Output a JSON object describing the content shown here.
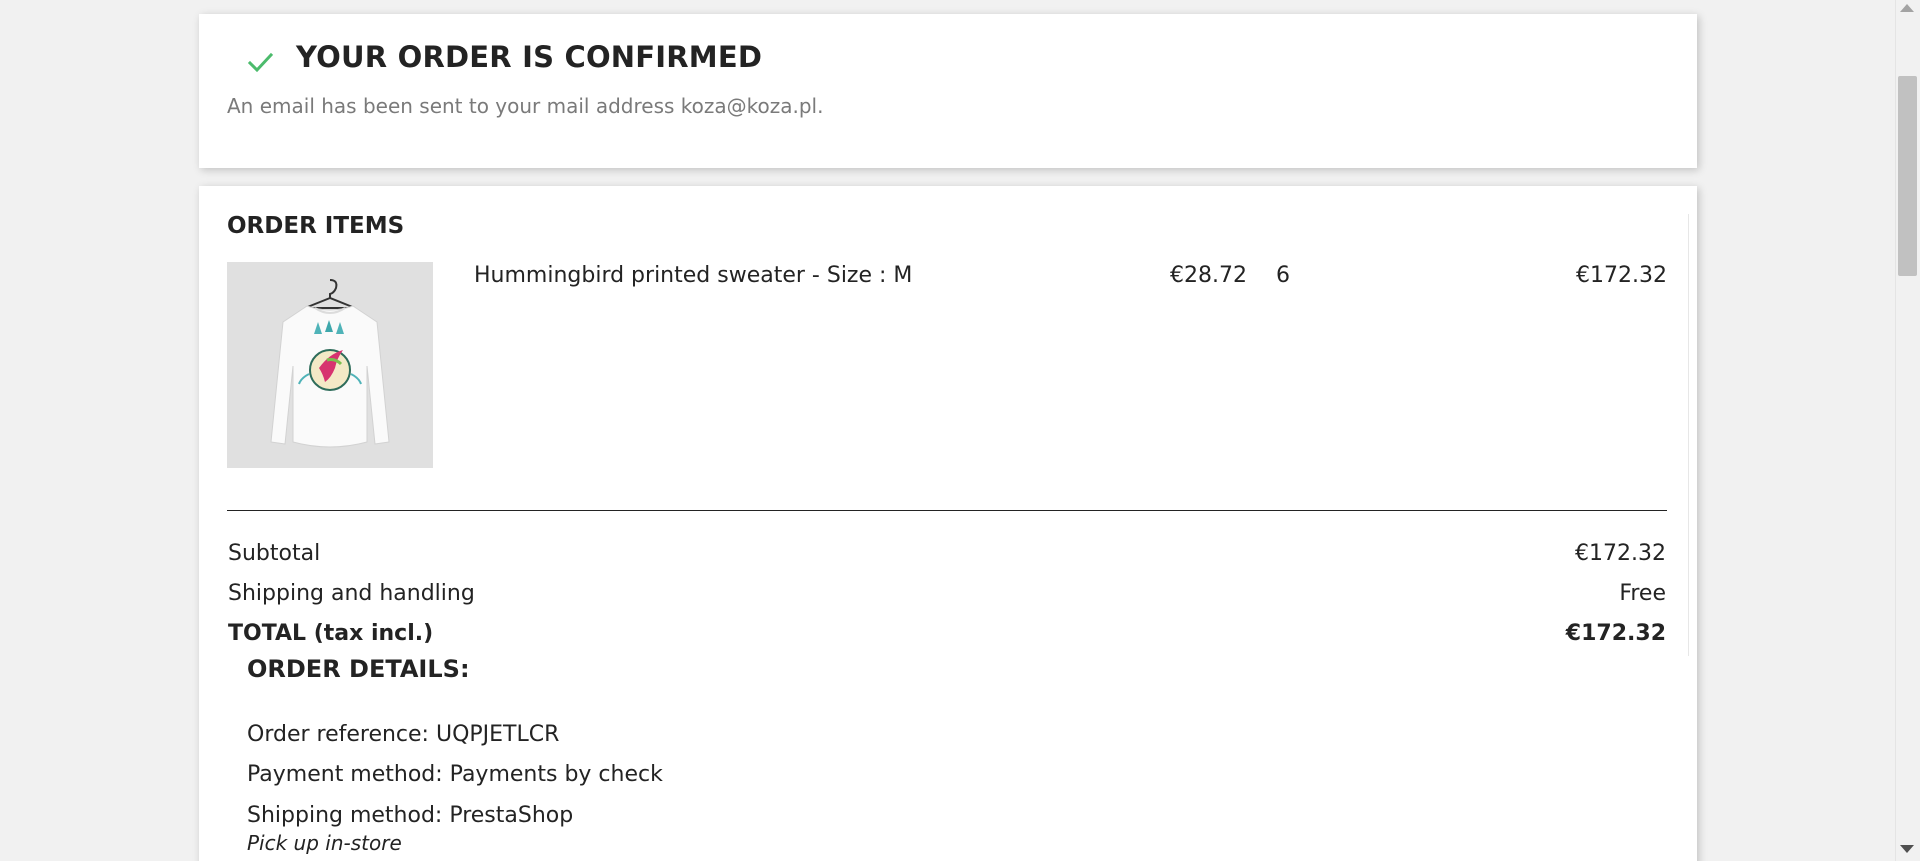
{
  "colors": {
    "accent_check": "#4cbb6c",
    "text": "#232323",
    "muted": "#7a7a7a",
    "background": "#f1f1f1"
  },
  "confirmation": {
    "icon": "check-icon",
    "title": "YOUR ORDER IS CONFIRMED",
    "message": "An email has been sent to your mail address koza@koza.pl."
  },
  "order_items": {
    "title": "ORDER ITEMS",
    "items": [
      {
        "image": "hummingbird-sweater-image",
        "name": "Hummingbird printed sweater - Size : M",
        "unit_price": "€28.72",
        "quantity": "6",
        "total": "€172.32"
      }
    ],
    "summary": {
      "subtotal_label": "Subtotal",
      "subtotal_value": "€172.32",
      "shipping_label": "Shipping and handling",
      "shipping_value": "Free",
      "total_label": "TOTAL (tax incl.)",
      "total_value": "€172.32"
    }
  },
  "order_details": {
    "title": "ORDER DETAILS:",
    "reference": "Order reference: UQPJETLCR",
    "payment": "Payment method: Payments by check",
    "shipping": "Shipping method: PrestaShop",
    "carrier_delay": "Pick up in-store"
  }
}
